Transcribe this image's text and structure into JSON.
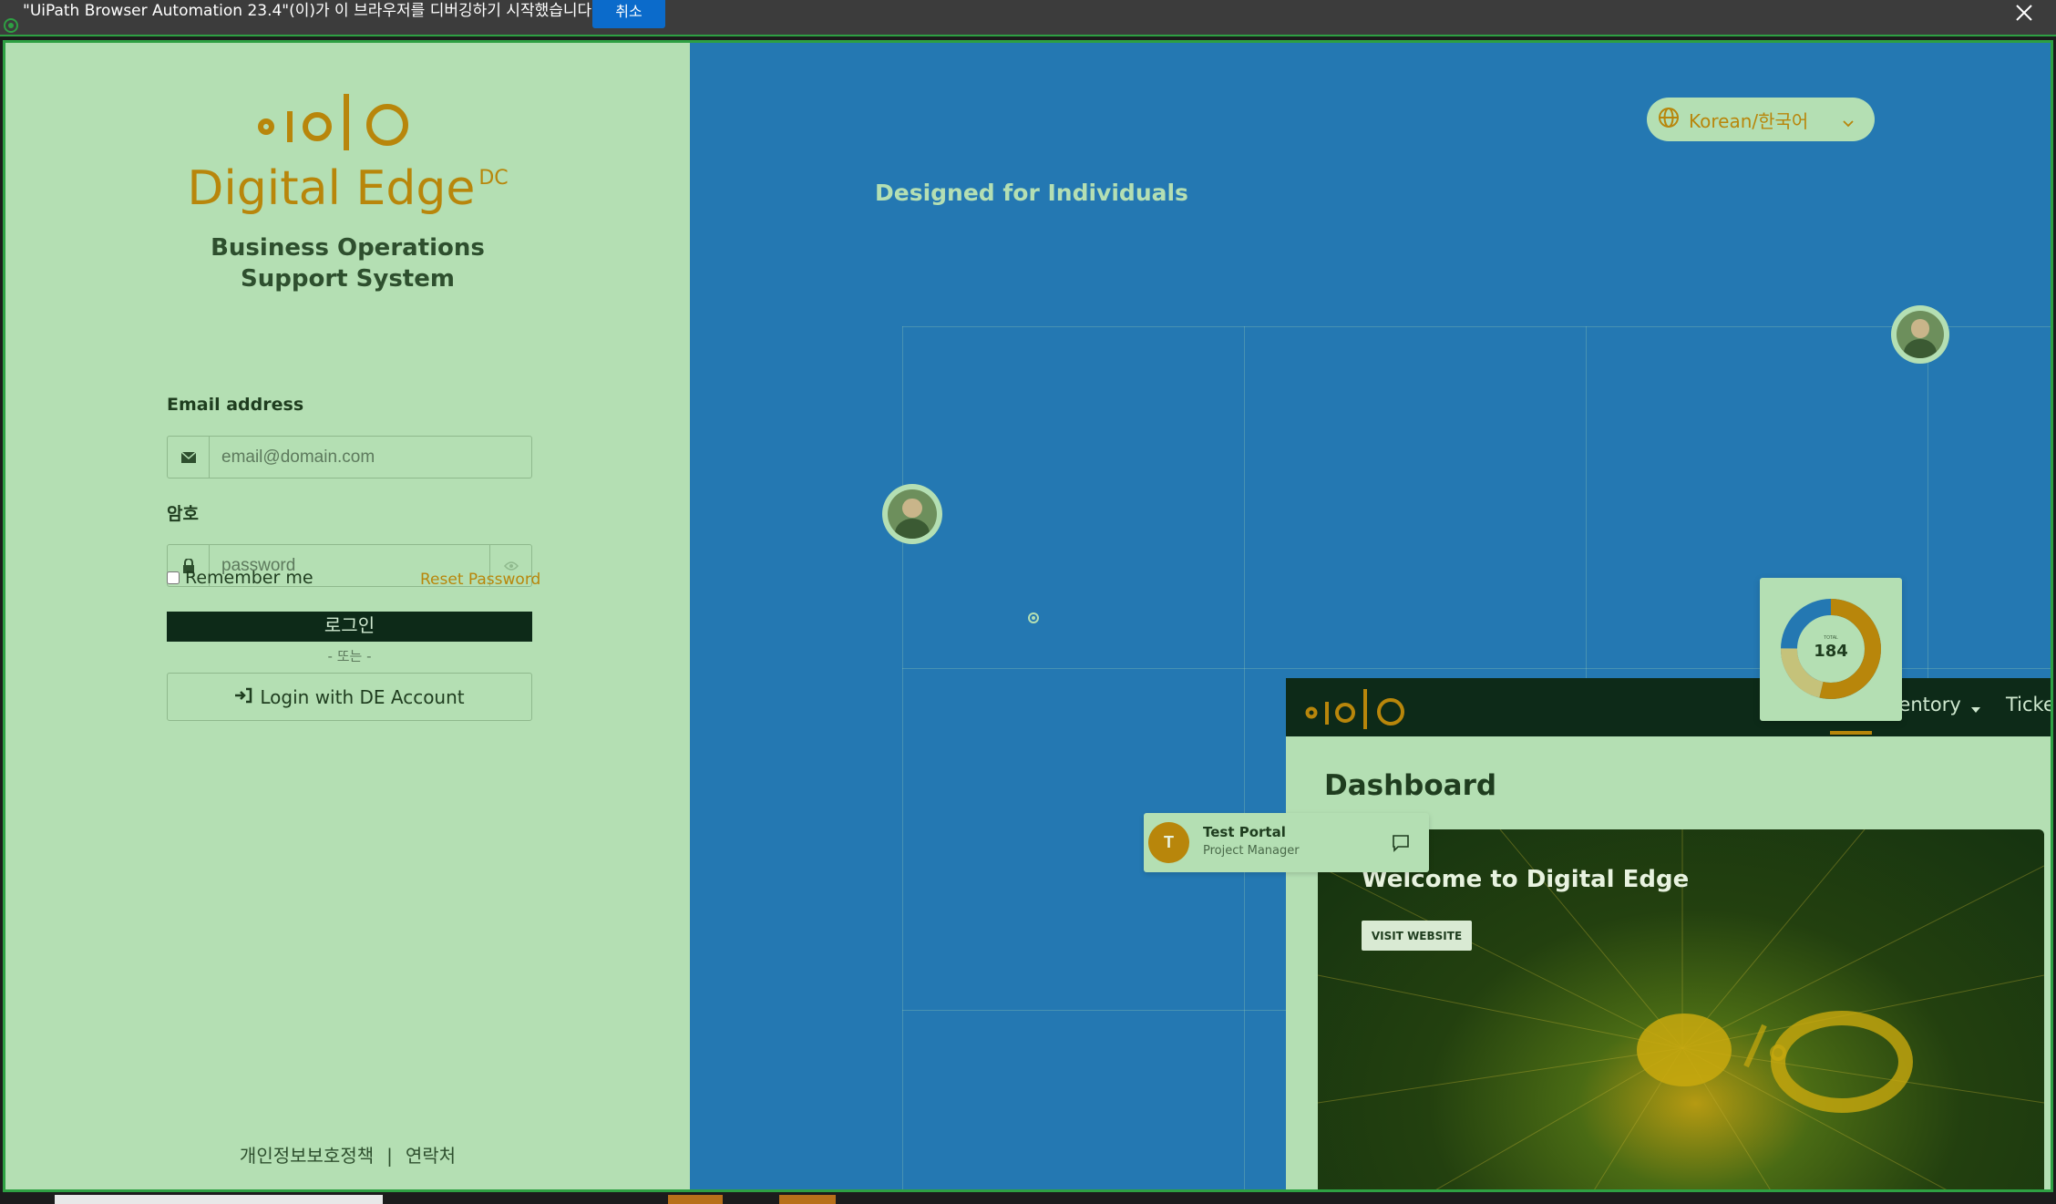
{
  "debug_bar": {
    "message": "\"UiPath Browser Automation 23.4\"(이)가 이 브라우저를 디버깅하기 시작했습니다.",
    "cancel_label": "취소",
    "close_icon": "close-icon"
  },
  "login": {
    "brand_name": "Digital Edge",
    "brand_suffix": "DC",
    "subtitle": "Business Operations Support System",
    "email_label": "Email address",
    "email_placeholder": "email@domain.com",
    "email_icon": "envelope-icon",
    "password_label": "암호",
    "password_placeholder": "password",
    "password_icon": "lock-icon",
    "toggle_icon": "eye-icon",
    "remember_label": "Remember me",
    "reset_label": "Reset Password",
    "login_button": "로그인",
    "or_text": "- 또는 -",
    "de_login_button": "Login with DE Account",
    "footer_privacy": "개인정보보호정책",
    "footer_separator": "|",
    "footer_contact": "연락처"
  },
  "hero": {
    "language": "Korean/한국어",
    "headline": "Designed for Individuals",
    "total_label": "TOTAL",
    "total_value": "184",
    "portal_initial": "T",
    "portal_name": "Test Portal",
    "portal_role": "Project Manager",
    "preview_nav_inventory": "ventory",
    "preview_nav_tickets": "Ticket",
    "preview_title": "Dashboard",
    "preview_welcome": "Welcome to Digital Edge",
    "preview_visit": "VISIT WEBSITE"
  },
  "colors": {
    "brand_gold": "#b8860b",
    "panel_green": "#b4dfb3",
    "hero_blue": "#2478b2",
    "dark_green": "#0d2a18"
  }
}
